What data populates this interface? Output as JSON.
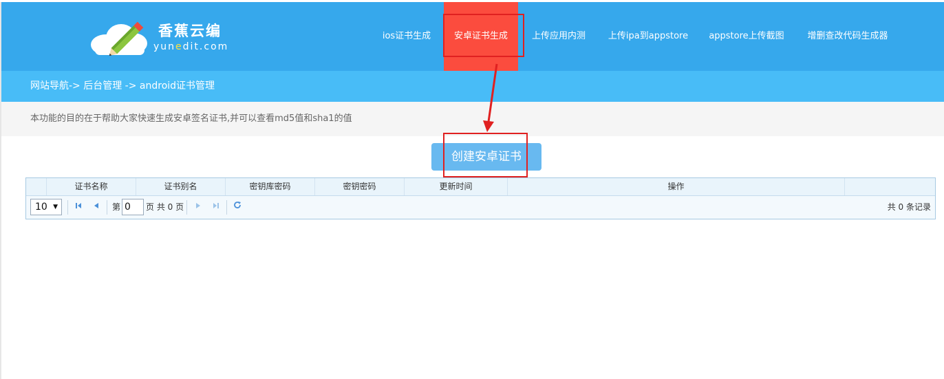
{
  "header": {
    "logo_title": "香蕉云编",
    "logo_domain_pre": "yun",
    "logo_domain_e": "e",
    "logo_domain_post": "dit.com",
    "nav": [
      {
        "label": "ios证书生成",
        "active": false
      },
      {
        "label": "安卓证书生成",
        "active": true
      },
      {
        "label": "上传应用内测",
        "active": false
      },
      {
        "label": "上传ipa到appstore",
        "active": false
      },
      {
        "label": "appstore上传截图",
        "active": false
      },
      {
        "label": "增删查改代码生成器",
        "active": false
      }
    ]
  },
  "breadcrumb": "网站导航-> 后台管理 -> android证书管理",
  "description": "本功能的目的在于帮助大家快速生成安卓签名证书,并可以查看md5值和sha1的值",
  "create_button": "创建安卓证书",
  "grid": {
    "columns": [
      "",
      "证书名称",
      "证书别名",
      "密钥库密码",
      "密钥密码",
      "更新时间",
      "操作",
      ""
    ],
    "rows": [],
    "pager": {
      "page_size": "10",
      "page_label_pre": "第",
      "page_value": "0",
      "page_label_post": "页 共 0 页",
      "total": "共 0 条记录"
    }
  },
  "colors": {
    "header_bg": "#36a8ec",
    "nav_active_bg": "#fb4c3e",
    "breadcrumb_bg": "#48bcf7",
    "button_bg": "#68b9f0",
    "annotation": "#e02020"
  },
  "icons": [
    "cloud-pencil-logo-icon",
    "first-page-icon",
    "prev-page-icon",
    "next-page-icon",
    "last-page-icon",
    "refresh-icon",
    "dropdown-caret-icon"
  ]
}
